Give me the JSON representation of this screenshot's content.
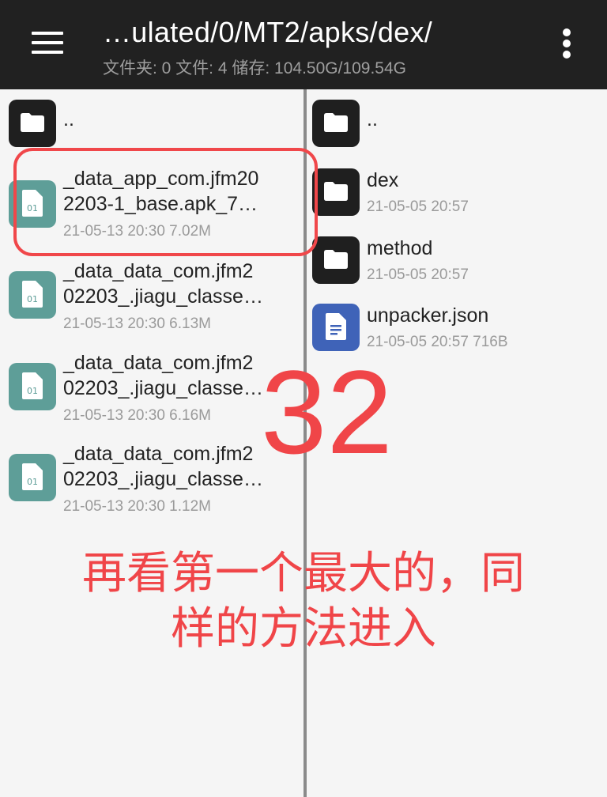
{
  "toolbar": {
    "path": "…ulated/0/MT2/apks/dex/",
    "info": "文件夹: 0  文件: 4  储存: 104.50G/109.54G"
  },
  "left_pane": {
    "up_label": "..",
    "items": [
      {
        "line1": "_data_app_com.jfm20",
        "line2": "2203-1_base.apk_7…",
        "meta": "21-05-13 20:30  7.02M",
        "icon": "binary-file-icon"
      },
      {
        "line1": "_data_data_com.jfm2",
        "line2": "02203_.jiagu_classe…",
        "meta": "21-05-13 20:30  6.13M",
        "icon": "binary-file-icon"
      },
      {
        "line1": "_data_data_com.jfm2",
        "line2": "02203_.jiagu_classe…",
        "meta": "21-05-13 20:30  6.16M",
        "icon": "binary-file-icon"
      },
      {
        "line1": "_data_data_com.jfm2",
        "line2": "02203_.jiagu_classe…",
        "meta": "21-05-13 20:30  1.12M",
        "icon": "binary-file-icon"
      }
    ]
  },
  "right_pane": {
    "up_label": "..",
    "items": [
      {
        "name": "dex",
        "meta": "21-05-05 20:57",
        "icon": "folder-icon"
      },
      {
        "name": "method",
        "meta": "21-05-05 20:57",
        "icon": "folder-icon"
      },
      {
        "name": "unpacker.json",
        "meta": "21-05-05 20:57  716B",
        "icon": "document-icon"
      }
    ]
  },
  "annotation": {
    "step_number": "32",
    "caption_line1": "再看第一个最大的，同",
    "caption_line2": "样的方法进入"
  },
  "colors": {
    "toolbar": "#212121",
    "folder_icon": "#1f1f1f",
    "binary_icon": "#5e9e98",
    "document_icon": "#3f63b8",
    "annotation_red": "#f04548"
  }
}
